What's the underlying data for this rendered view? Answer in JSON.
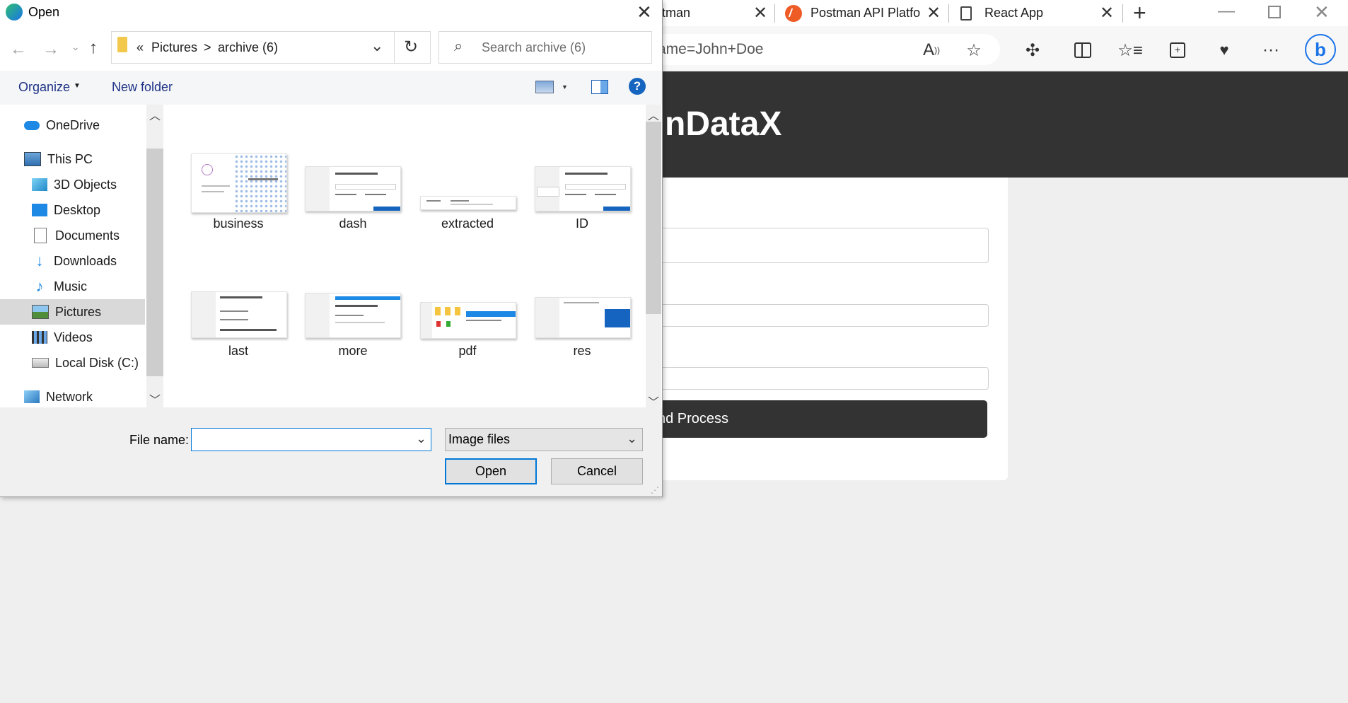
{
  "browser": {
    "tabs": [
      {
        "label": "tman"
      },
      {
        "label": "Postman API Platfo"
      },
      {
        "label": "React App"
      }
    ],
    "address": "ame=John+Doe"
  },
  "page": {
    "brand": "nDataX",
    "button_label": "nd Process"
  },
  "dialog": {
    "title": "Open",
    "breadcrumb": [
      "«",
      "Pictures",
      ">",
      "archive (6)"
    ],
    "search_placeholder": "Search archive (6)",
    "organize_label": "Organize",
    "new_folder_label": "New folder",
    "nav_items": [
      {
        "label": "OneDrive"
      },
      {
        "label": "This PC"
      },
      {
        "label": "3D Objects"
      },
      {
        "label": "Desktop"
      },
      {
        "label": "Documents"
      },
      {
        "label": "Downloads"
      },
      {
        "label": "Music"
      },
      {
        "label": "Pictures"
      },
      {
        "label": "Videos"
      },
      {
        "label": "Local Disk (C:)"
      },
      {
        "label": "Network"
      }
    ],
    "files": [
      {
        "label": "business"
      },
      {
        "label": "dash"
      },
      {
        "label": "extracted"
      },
      {
        "label": "ID"
      },
      {
        "label": "last"
      },
      {
        "label": "more"
      },
      {
        "label": "pdf"
      },
      {
        "label": "res"
      }
    ],
    "file_name_label": "File name:",
    "file_name_value": "",
    "file_type": "Image files",
    "open_label": "Open",
    "cancel_label": "Cancel"
  }
}
